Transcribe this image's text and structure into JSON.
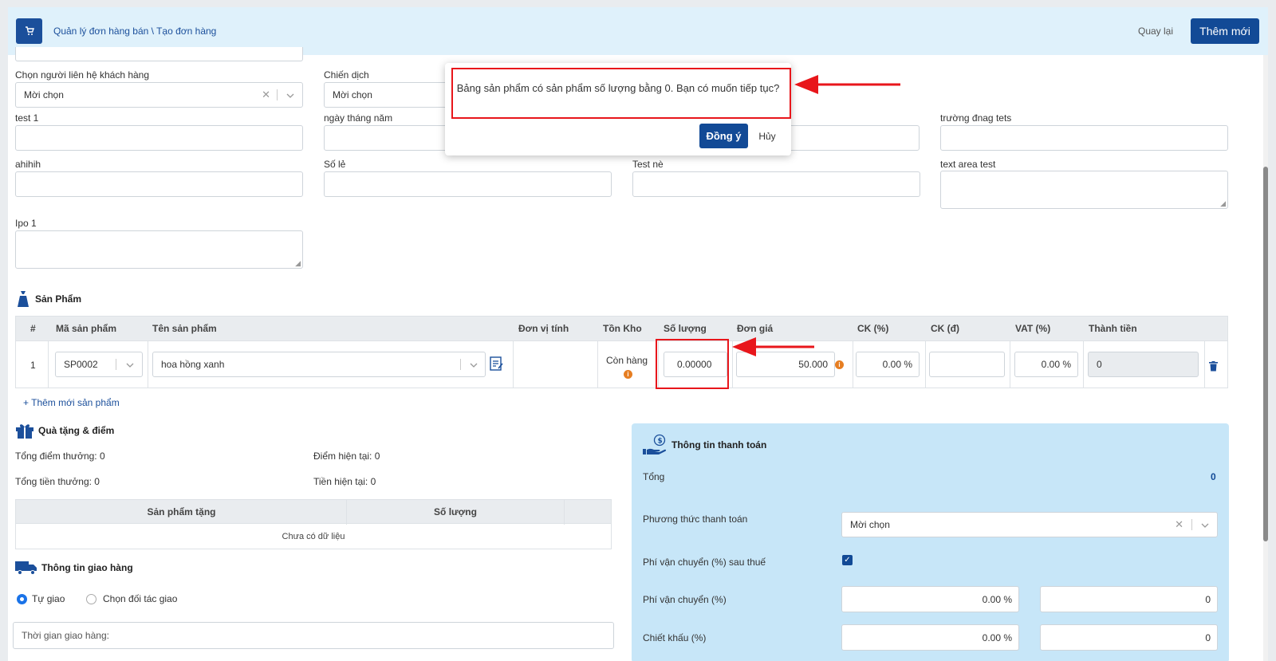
{
  "header": {
    "breadcrumb": "Quản lý đơn hàng bán \\ Tạo đơn hàng",
    "back_label": "Quay lại",
    "add_label": "Thêm mới"
  },
  "form": {
    "contact_label": "Chọn người liên hệ khách hàng",
    "contact_value": "Mời chọn",
    "campaign_label": "Chiến dịch",
    "campaign_value": "Mời chọn",
    "test1_label": "test 1",
    "date_label": "ngày tháng năm",
    "tests_label": "trường đnag tets",
    "ahihih_label": "ahihih",
    "sole_label": "Số lẻ",
    "testne_label": "Test nè",
    "textarea_label": "text area test",
    "ipo_label": "Ipo 1"
  },
  "products": {
    "title": "Sản Phẩm",
    "columns": [
      "#",
      "Mã sản phẩm",
      "Tên sản phẩm",
      "Đơn vị tính",
      "Tồn Kho",
      "Số lượng",
      "Đơn giá",
      "CK (%)",
      "CK (đ)",
      "VAT (%)",
      "Thành tiền"
    ],
    "row": {
      "index": "1",
      "code": "SP0002",
      "name": "hoa hồng xanh",
      "stock": "Còn hàng",
      "quantity": "0.00000",
      "price": "50.000",
      "ck_percent": "0.00 %",
      "vat": "0.00 %",
      "total": "0"
    },
    "add_product": "+ Thêm mới sản phẩm"
  },
  "gifts": {
    "title": "Quà tặng & điểm",
    "total_points": "Tổng điểm thưởng: 0",
    "current_points": "Điểm hiện tại: 0",
    "total_bonus": "Tổng tiền thưởng: 0",
    "current_money": "Tiền hiện tại: 0",
    "col_product": "Sản phẩm tặng",
    "col_qty": "Số lượng",
    "empty": "Chưa có dữ liệu"
  },
  "delivery": {
    "title": "Thông tin giao hàng",
    "opt_self": "Tự giao",
    "opt_partner": "Chọn đối tác giao",
    "time_placeholder": "Thời gian giao hàng:"
  },
  "payment": {
    "title": "Thông tin thanh toán",
    "total_label": "Tổng",
    "total_value": "0",
    "method_label": "Phương thức thanh toán",
    "method_value": "Mời chọn",
    "ship_after_tax_label": "Phí vận chuyển (%) sau thuế",
    "ship_label": "Phí vận chuyển (%)",
    "ship_percent": "0.00 %",
    "ship_amount": "0",
    "discount_label": "Chiết khấu (%)",
    "discount_percent": "0.00 %",
    "discount_amount": "0"
  },
  "dialog": {
    "message": "Bảng sản phẩm có sản phẩm số lượng bằng 0. Bạn có muốn tiếp tục?",
    "ok_label": "Đồng ý",
    "cancel_label": "Hủy"
  },
  "colors": {
    "primary": "#124a96",
    "header_bg": "#dff1fb",
    "payment_bg": "#c7e6f8",
    "annotation_red": "#e8161b"
  }
}
